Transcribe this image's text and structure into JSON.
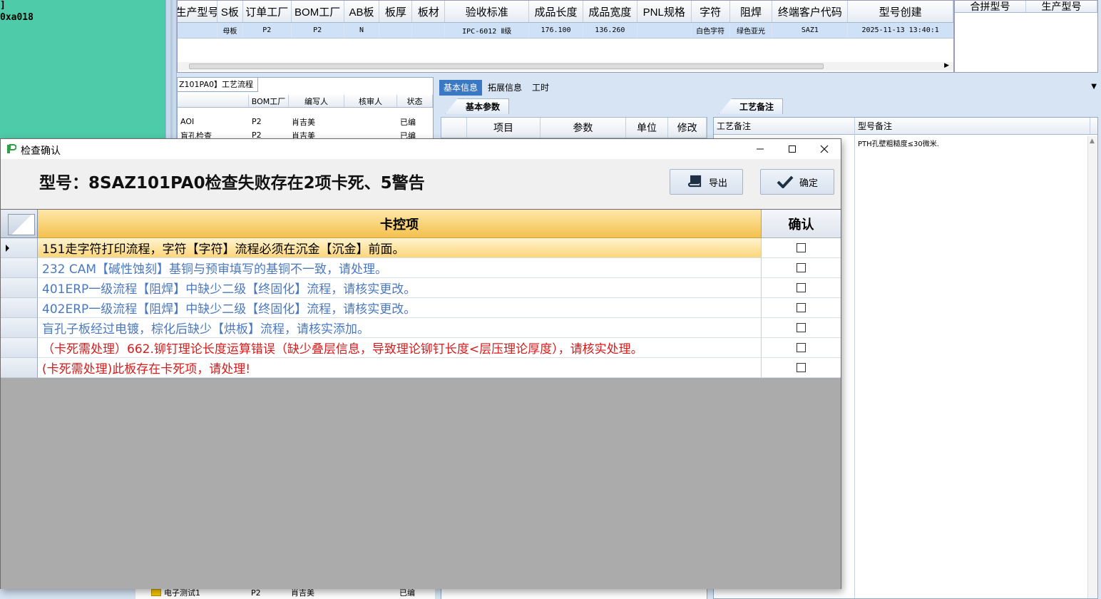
{
  "bg": {
    "left_text1": "]",
    "left_text2": "0xa018",
    "top_columns": [
      "生产型号",
      "S板",
      "订单工厂",
      "BOM工厂",
      "AB板",
      "板厚",
      "板材",
      "验收标准",
      "成品长度",
      "成品宽度",
      "PNL规格",
      "字符",
      "阻焊",
      "终端客户代码",
      "型号创建"
    ],
    "top_row": [
      "",
      "母板",
      "P2",
      "P2",
      "N",
      "",
      "",
      "IPC-6012 Ⅱ级",
      "176.100",
      "136.260",
      "",
      "白色字符",
      "绿色亚光",
      "SAZ1",
      "2025-11-13 13:40:1"
    ],
    "right_columns": [
      "合拼型号",
      "生产型号"
    ],
    "proc_title": "Z101PA0】工艺流程",
    "proc_columns": [
      "",
      "BOM工厂",
      "编写人",
      "核审人",
      "状态"
    ],
    "proc_rows": [
      [
        "AOI",
        "P2",
        "肖吉美",
        "",
        "已编"
      ],
      [
        "盲孔检查",
        "P2",
        "肖吉美",
        "",
        "已编"
      ]
    ],
    "tabs": [
      "基本信息",
      "拓展信息",
      "工时"
    ],
    "subtab_basic": "基本参数",
    "subtab_note": "工艺备注",
    "param_columns": [
      "项目",
      "参数",
      "单位",
      "修改"
    ],
    "note_columns": [
      "工艺备注",
      "型号备注"
    ],
    "note_text": "PTH孔壁粗糙度≤30微米.",
    "tree_row": [
      "电子测试1",
      "P2",
      "肖吉美",
      "",
      "已编"
    ]
  },
  "dialog": {
    "title": "检查确认",
    "heading": "型号：8SAZ101PA0检查失败存在2项卡死、5警告",
    "export_label": "导出",
    "confirm_label": "确定",
    "col_item": "卡控项",
    "col_confirm": "确认",
    "rows": [
      {
        "text": "151走字符打印流程，字符【字符】流程必须在沉金【沉金】前面。",
        "color": "black",
        "selected": true
      },
      {
        "text": "232 CAM【碱性蚀刻】基铜与预审填写的基铜不一致，请处理。",
        "color": "blue"
      },
      {
        "text": "401ERP一级流程【阻焊】中缺少二级【终固化】流程，请核实更改。",
        "color": "blue"
      },
      {
        "text": "402ERP一级流程【阻焊】中缺少二级【终固化】流程，请核实更改。",
        "color": "blue"
      },
      {
        "text": "盲孔子板经过电镀，棕化后缺少【烘板】流程，请核实添加。",
        "color": "blue"
      },
      {
        "text": "（卡死需处理）662.铆钉理论长度运算错误（缺少叠层信息，导致理论铆钉长度<层压理论厚度），请核实处理。",
        "color": "red"
      },
      {
        "text": "(卡死需处理)此板存在卡死项，请处理!",
        "color": "red"
      }
    ],
    "colors": {
      "selected_row": "#fbd57a",
      "header": "#f5c14e",
      "blue_text": "#4a78c0",
      "red_text": "#d81a1a"
    }
  }
}
